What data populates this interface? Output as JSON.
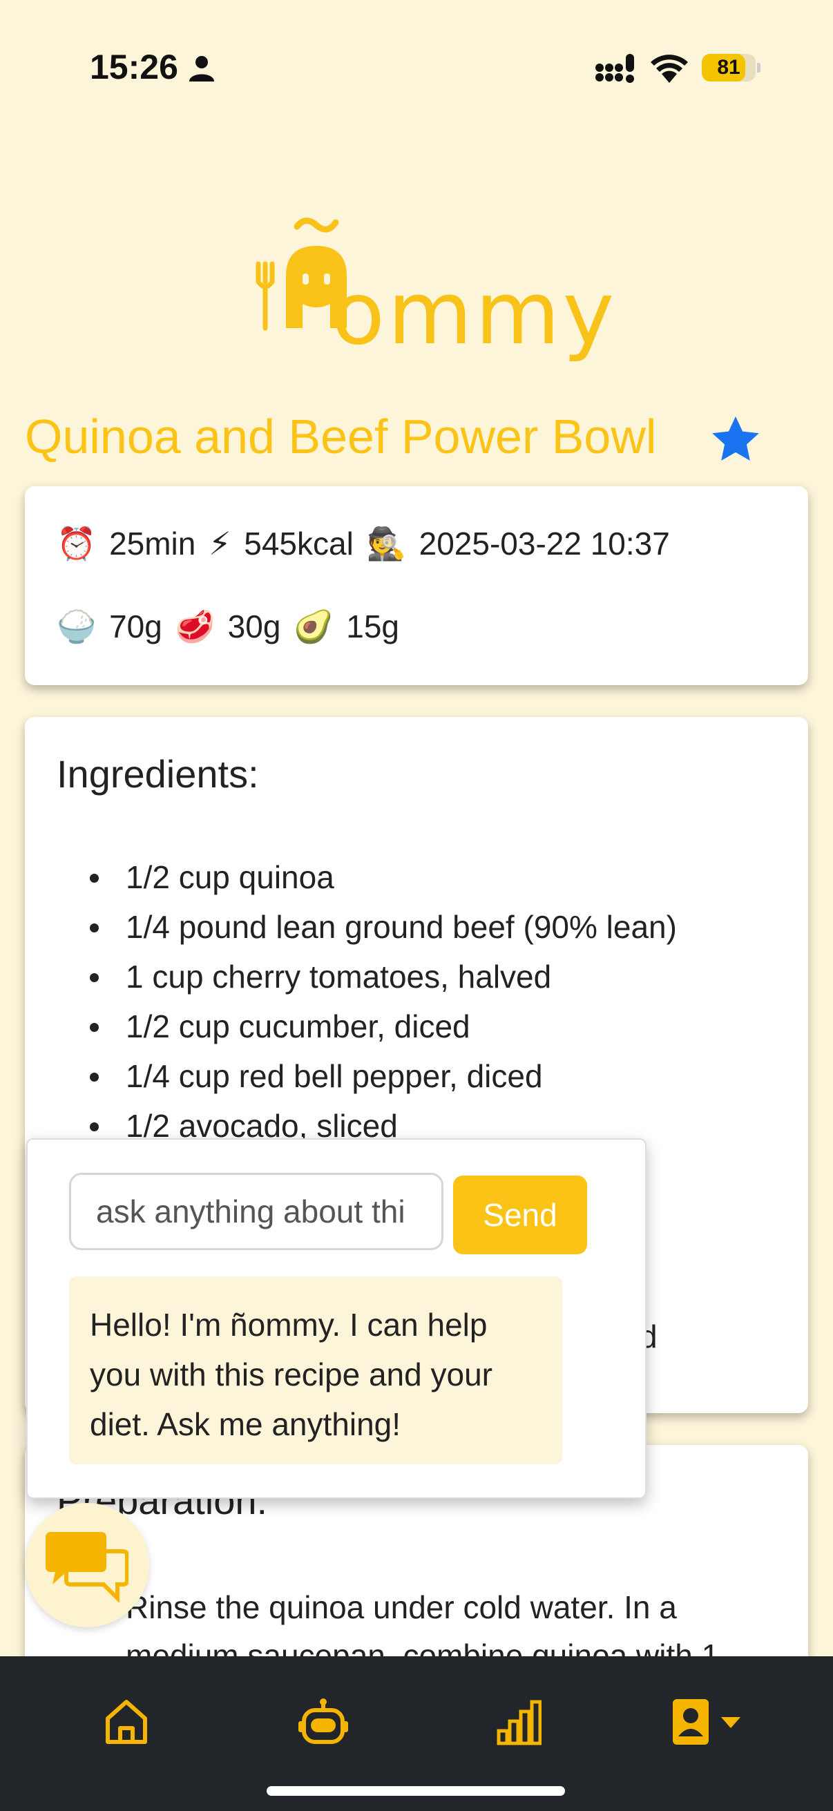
{
  "status_bar": {
    "time": "15:26",
    "battery": "81",
    "battery_level": 0.81,
    "icons": [
      "person-icon",
      "signal-icon",
      "wifi-icon",
      "battery-icon"
    ]
  },
  "app": {
    "logo_text": "ñommy",
    "accent_color": "#fbc315",
    "star_color": "#1a73f0"
  },
  "recipe": {
    "title": "Quinoa and Beef Power Bowl",
    "time_emoji": "⏰",
    "time": "25min",
    "kcal_emoji": "⚡",
    "kcal": "545kcal",
    "author_emoji": "🕵",
    "date": "2025-03-22 10:37",
    "carbs_emoji": "🍚",
    "carbs": "70g",
    "protein_emoji": "🥩",
    "protein": "30g",
    "fat_emoji": "🥑",
    "fat": "15g"
  },
  "ingredients": {
    "heading": "Ingredients:",
    "items": [
      "1/2 cup quinoa",
      "1/4 pound lean ground beef (90% lean)",
      "1 cup cherry tomatoes, halved",
      "1/2 cup cucumber, diced",
      "1/4 cup red bell pepper, diced",
      "1/2 avocado, sliced"
    ],
    "partial_text": "d"
  },
  "preparation": {
    "heading": "Preparation:",
    "step_text": "Rinse the quinoa under cold water. In a medium saucepan, combine quinoa with 1"
  },
  "chat": {
    "input_placeholder": "ask anything about thi",
    "send_label": "Send",
    "greeting": "Hello! I'm ñommy. I can help you with this recipe and your diet. Ask me anything!"
  },
  "nav": {
    "items": [
      "home-icon",
      "robot-icon",
      "stats-icon",
      "profile-icon"
    ]
  }
}
